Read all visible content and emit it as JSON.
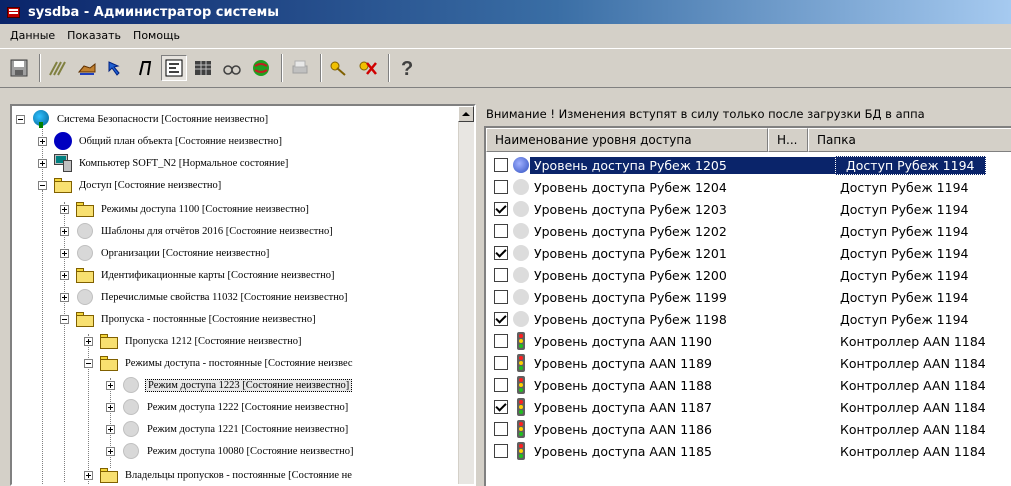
{
  "window": {
    "title": "sysdba - Администратор системы"
  },
  "menu": [
    "Данные",
    "Показать",
    "Помощь"
  ],
  "toolbar": {
    "icons": [
      "save-icon",
      "hatch-icon",
      "dog-icon",
      "arrow-icon",
      "run-icon",
      "props-icon",
      "grid-icon",
      "glasses-icon",
      "globe-icon",
      "print-icon",
      "key-add-icon",
      "key-remove-icon",
      "help-icon"
    ]
  },
  "tree": {
    "items": [
      {
        "label": "Система Безопасности [Состояние неизвестно]",
        "icon": "globe"
      },
      {
        "label": "Общий план объекта [Состояние неизвестно]",
        "icon": "blue"
      },
      {
        "label": "Компьютер SOFT_N2 [Нормальное состояние]",
        "icon": "pc"
      },
      {
        "label": "Доступ [Состояние неизвестно]",
        "icon": "folder"
      },
      {
        "label": "Режимы доступа 1100 [Состояние неизвестно]",
        "icon": "folder"
      },
      {
        "label": "Шаблоны для отчётов 2016 [Состояние неизвестно]",
        "icon": "gray"
      },
      {
        "label": "Организации [Состояние неизвестно]",
        "icon": "gray"
      },
      {
        "label": "Идентификационные карты [Состояние неизвестно]",
        "icon": "folder"
      },
      {
        "label": "Перечислимые свойства 11032 [Состояние неизвестно]",
        "icon": "gray"
      },
      {
        "label": "Пропуска - постоянные [Состояние неизвестно]",
        "icon": "folder"
      },
      {
        "label": "Пропуска 1212 [Состояние неизвестно]",
        "icon": "folder"
      },
      {
        "label": "Режимы доступа - постоянные [Состояние неизвес",
        "icon": "folder"
      },
      {
        "label": "Режим доступа 1223 [Состояние неизвестно]",
        "icon": "gray"
      },
      {
        "label": "Режим доступа 1222 [Состояние неизвестно]",
        "icon": "gray"
      },
      {
        "label": "Режим доступа 1221 [Состояние неизвестно]",
        "icon": "gray"
      },
      {
        "label": "Режим доступа 10080 [Состояние неизвестно]",
        "icon": "gray"
      },
      {
        "label": "Владельцы пропусков - постоянные [Состояние не",
        "icon": "folder"
      }
    ]
  },
  "notice": "Внимание ! Изменения вступят в силу только после загрузки БД в аппа",
  "list": {
    "columns": [
      "Наименование уровня доступа",
      "Н...",
      "Папка"
    ],
    "rows": [
      {
        "name": "Уровень доступа Рубеж 1205",
        "folder": "Доступ Рубеж 1194",
        "checked": false,
        "icon": "blue"
      },
      {
        "name": "Уровень доступа Рубеж 1204",
        "folder": "Доступ Рубеж 1194",
        "checked": false,
        "icon": "gray"
      },
      {
        "name": "Уровень доступа Рубеж 1203",
        "folder": "Доступ Рубеж 1194",
        "checked": true,
        "icon": "gray"
      },
      {
        "name": "Уровень доступа Рубеж 1202",
        "folder": "Доступ Рубеж 1194",
        "checked": false,
        "icon": "gray"
      },
      {
        "name": "Уровень доступа Рубеж 1201",
        "folder": "Доступ Рубеж 1194",
        "checked": true,
        "icon": "gray"
      },
      {
        "name": "Уровень доступа Рубеж 1200",
        "folder": "Доступ Рубеж 1194",
        "checked": false,
        "icon": "gray"
      },
      {
        "name": "Уровень доступа Рубеж 1199",
        "folder": "Доступ Рубеж 1194",
        "checked": false,
        "icon": "gray"
      },
      {
        "name": "Уровень доступа Рубеж 1198",
        "folder": "Доступ Рубеж 1194",
        "checked": true,
        "icon": "gray"
      },
      {
        "name": "Уровень доступа AAN 1190",
        "folder": "Контроллер AAN 1184",
        "checked": false,
        "icon": "light"
      },
      {
        "name": "Уровень доступа AAN 1189",
        "folder": "Контроллер AAN 1184",
        "checked": false,
        "icon": "light"
      },
      {
        "name": "Уровень доступа AAN 1188",
        "folder": "Контроллер AAN 1184",
        "checked": false,
        "icon": "light"
      },
      {
        "name": "Уровень доступа AAN 1187",
        "folder": "Контроллер AAN 1184",
        "checked": true,
        "icon": "light"
      },
      {
        "name": "Уровень доступа AAN 1186",
        "folder": "Контроллер AAN 1184",
        "checked": false,
        "icon": "light"
      },
      {
        "name": "Уровень доступа AAN 1185",
        "folder": "Контроллер AAN 1184",
        "checked": false,
        "icon": "light"
      }
    ]
  }
}
